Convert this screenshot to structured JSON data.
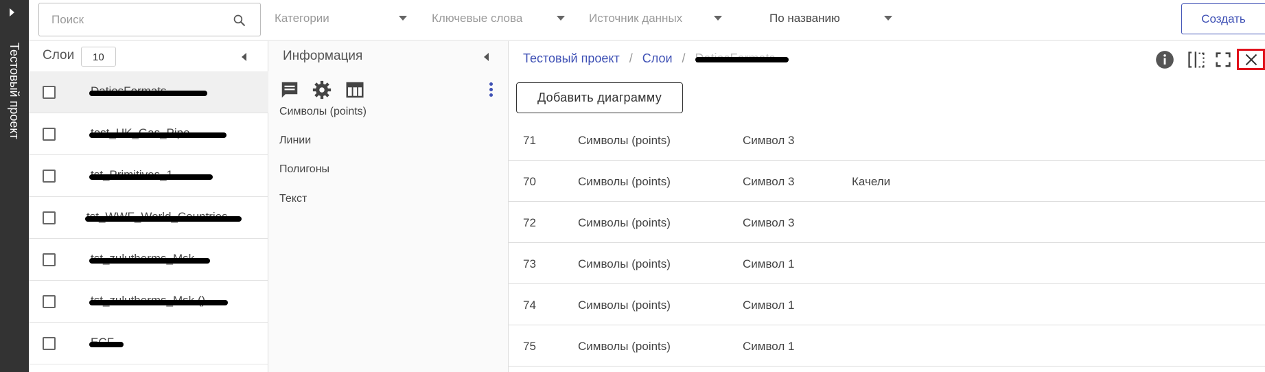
{
  "sidebar": {
    "project_title": "Тестовый проект"
  },
  "topbar": {
    "search_placeholder": "Поиск",
    "filters": [
      "Категории",
      "Ключевые слова",
      "Источник данных"
    ],
    "sort_label": "По названию",
    "create_label": "Создать"
  },
  "layers": {
    "title": "Слои",
    "count": "10",
    "items": [
      {
        "label": "DatiosFormats"
      },
      {
        "label": "test_UK_Gas_Pipe"
      },
      {
        "label": "tst_Primitives_1"
      },
      {
        "label": "tst_WWF_World_Countries"
      },
      {
        "label": "tst_zulutherms_Msk"
      },
      {
        "label": "tst_zulutherms_Msk ()"
      },
      {
        "label": "ECF"
      }
    ]
  },
  "info": {
    "title": "Информация",
    "items": [
      "Символы (points)",
      "Линии",
      "Полигоны",
      "Текст"
    ]
  },
  "detail": {
    "breadcrumb": [
      "Тестовый проект",
      "Слои",
      "DatiosFormats"
    ],
    "add_chart_label": "Добавить диаграмму",
    "rows": [
      {
        "id": "71",
        "type": "Символы (points)",
        "symbol": "Символ 3",
        "extra": ""
      },
      {
        "id": "70",
        "type": "Символы (points)",
        "symbol": "Символ 3",
        "extra": "Качели"
      },
      {
        "id": "72",
        "type": "Символы (points)",
        "symbol": "Символ 3",
        "extra": ""
      },
      {
        "id": "73",
        "type": "Символы (points)",
        "symbol": "Символ 1",
        "extra": ""
      },
      {
        "id": "74",
        "type": "Символы (points)",
        "symbol": "Символ 1",
        "extra": ""
      },
      {
        "id": "75",
        "type": "Символы (points)",
        "symbol": "Символ 1",
        "extra": ""
      }
    ]
  },
  "colors": {
    "accent": "#3f51b5",
    "sidebar": "#333333",
    "highlight": "#e0121c"
  },
  "icons": [
    "search-icon",
    "comment-icon",
    "gear-icon",
    "table-icon",
    "more-vert-icon",
    "info-icon",
    "split-view-icon",
    "fullscreen-icon",
    "close-icon"
  ]
}
